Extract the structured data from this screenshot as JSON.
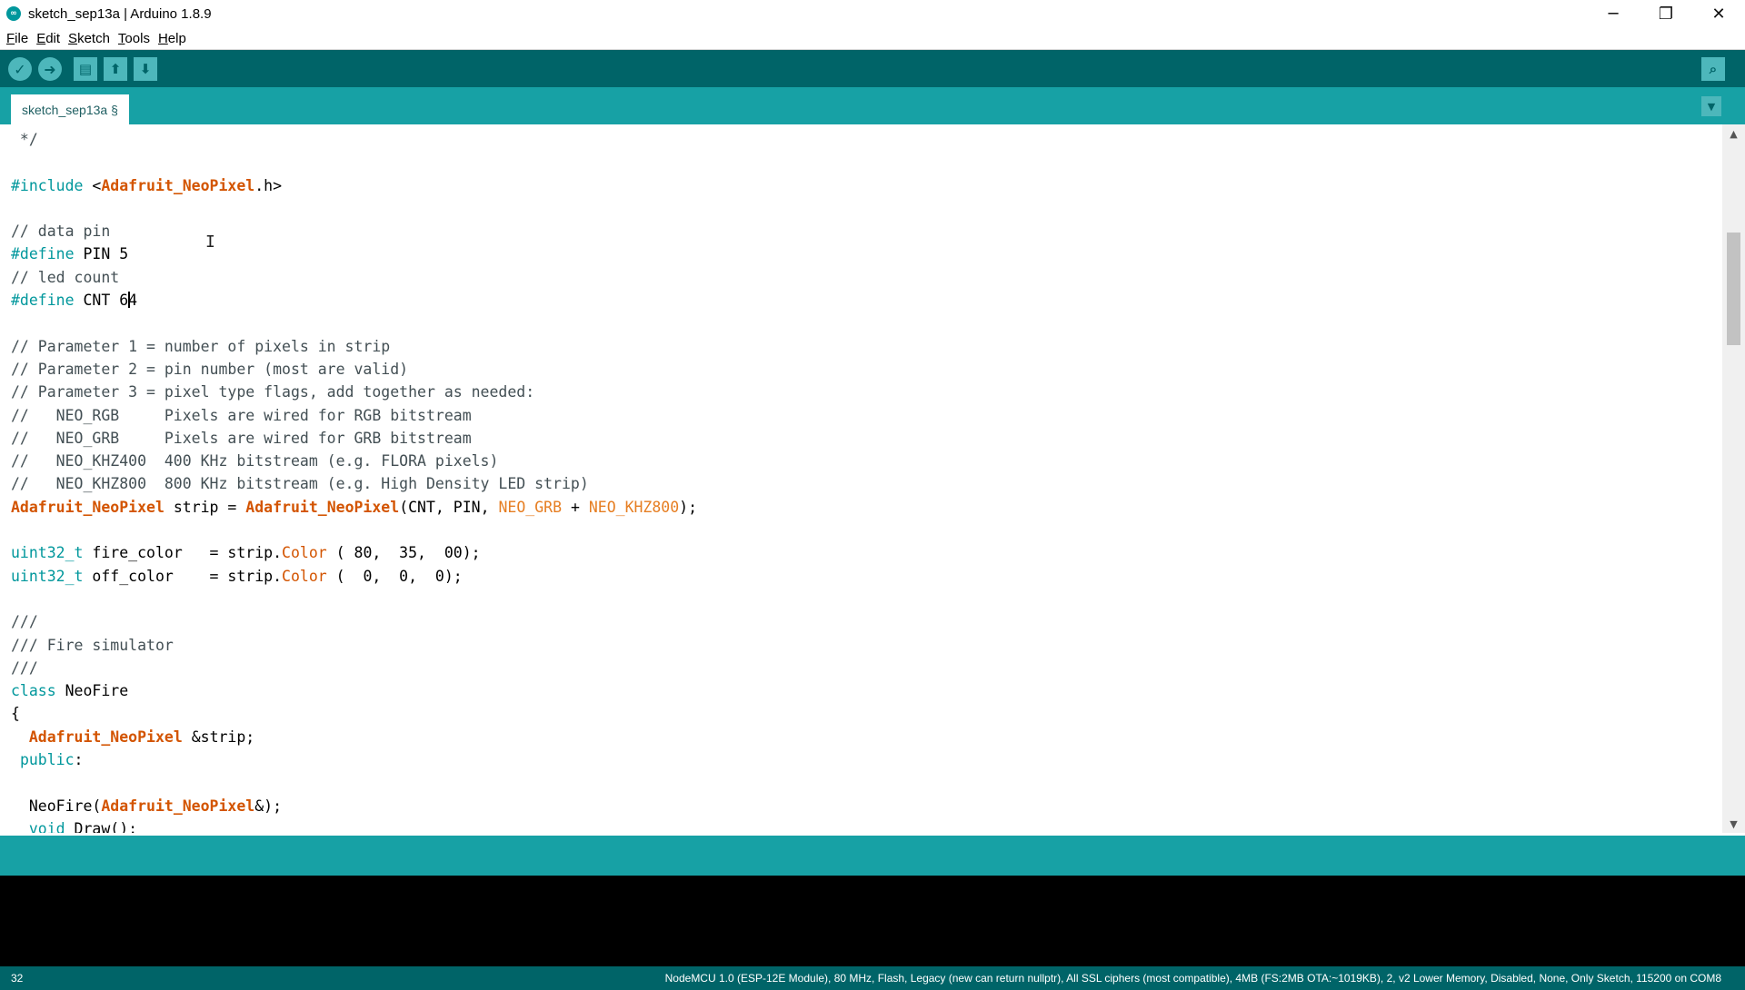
{
  "window": {
    "title": "sketch_sep13a | Arduino 1.8.9",
    "app_icon": "arduino-logo-icon",
    "controls": {
      "minimize": "─",
      "restore": "❐",
      "close": "✕"
    }
  },
  "menu": [
    "File",
    "Edit",
    "Sketch",
    "Tools",
    "Help"
  ],
  "toolbar": {
    "verify": "✓",
    "upload": "➜",
    "new": "▤",
    "open": "⬆",
    "save": "⬇",
    "serial_monitor": "⌕"
  },
  "tabs": {
    "active": "sketch_sep13a §",
    "menu": "▼"
  },
  "editor": {
    "lines": [
      [
        {
          "t": " */",
          "c": "cm"
        }
      ],
      [],
      [
        {
          "t": "#include ",
          "c": "kw"
        },
        {
          "t": "<",
          "c": ""
        },
        {
          "t": "Adafruit_NeoPixel",
          "c": "ty"
        },
        {
          "t": ".h>",
          "c": ""
        }
      ],
      [],
      [
        {
          "t": "// data pin",
          "c": "cm"
        }
      ],
      [
        {
          "t": "#define",
          "c": "kw"
        },
        {
          "t": " PIN 5",
          "c": ""
        }
      ],
      [
        {
          "t": "// led count",
          "c": "cm"
        }
      ],
      [
        {
          "t": "#define",
          "c": "kw"
        },
        {
          "t": " CNT 6",
          "c": ""
        },
        {
          "t": "|",
          "c": "caret"
        },
        {
          "t": "4",
          "c": ""
        }
      ],
      [],
      [
        {
          "t": "// Parameter 1 = number of pixels in strip",
          "c": "cm"
        }
      ],
      [
        {
          "t": "// Parameter 2 = pin number (most are valid)",
          "c": "cm"
        }
      ],
      [
        {
          "t": "// Parameter 3 = pixel type flags, add together as needed:",
          "c": "cm"
        }
      ],
      [
        {
          "t": "//   NEO_RGB     Pixels are wired for RGB bitstream",
          "c": "cm"
        }
      ],
      [
        {
          "t": "//   NEO_GRB     Pixels are wired for GRB bitstream",
          "c": "cm"
        }
      ],
      [
        {
          "t": "//   NEO_KHZ400  400 KHz bitstream (e.g. FLORA pixels)",
          "c": "cm"
        }
      ],
      [
        {
          "t": "//   NEO_KHZ800  800 KHz bitstream (e.g. High Density LED strip)",
          "c": "cm"
        }
      ],
      [
        {
          "t": "Adafruit_NeoPixel",
          "c": "ty"
        },
        {
          "t": " strip = ",
          "c": ""
        },
        {
          "t": "Adafruit_NeoPixel",
          "c": "ty"
        },
        {
          "t": "(CNT, PIN, ",
          "c": ""
        },
        {
          "t": "NEO_GRB",
          "c": "cs"
        },
        {
          "t": " + ",
          "c": ""
        },
        {
          "t": "NEO_KHZ800",
          "c": "cs"
        },
        {
          "t": ");",
          "c": ""
        }
      ],
      [],
      [
        {
          "t": "uint32_t",
          "c": "kw"
        },
        {
          "t": " fire_color   = strip.",
          "c": ""
        },
        {
          "t": "Color",
          "c": "fn"
        },
        {
          "t": " ( 80,  35,  00);",
          "c": ""
        }
      ],
      [
        {
          "t": "uint32_t",
          "c": "kw"
        },
        {
          "t": " off_color    = strip.",
          "c": ""
        },
        {
          "t": "Color",
          "c": "fn"
        },
        {
          "t": " (  0,  0,  0);",
          "c": ""
        }
      ],
      [],
      [
        {
          "t": "///",
          "c": "cm"
        }
      ],
      [
        {
          "t": "/// Fire simulator",
          "c": "cm"
        }
      ],
      [
        {
          "t": "///",
          "c": "cm"
        }
      ],
      [
        {
          "t": "class",
          "c": "kw"
        },
        {
          "t": " NeoFire",
          "c": ""
        }
      ],
      [
        {
          "t": "{",
          "c": ""
        }
      ],
      [
        {
          "t": "  ",
          "c": ""
        },
        {
          "t": "Adafruit_NeoPixel",
          "c": "ty"
        },
        {
          "t": " &strip;",
          "c": ""
        }
      ],
      [
        {
          "t": " ",
          "c": ""
        },
        {
          "t": "public",
          "c": "kw"
        },
        {
          "t": ":",
          "c": ""
        }
      ],
      [],
      [
        {
          "t": "  NeoFire(",
          "c": ""
        },
        {
          "t": "Adafruit_NeoPixel",
          "c": "ty"
        },
        {
          "t": "&);",
          "c": ""
        }
      ],
      [
        {
          "t": "  ",
          "c": ""
        },
        {
          "t": "void",
          "c": "kw"
        },
        {
          "t": " Draw();",
          "c": ""
        }
      ]
    ]
  },
  "scrollbar": {
    "up": "▲",
    "down": "▼"
  },
  "status": {
    "line": "32",
    "board": "NodeMCU 1.0 (ESP-12E Module), 80 MHz, Flash, Legacy (new can return nullptr), All SSL ciphers (most compatible), 4MB (FS:2MB OTA:~1019KB), 2, v2 Lower Memory, Disabled, None, Only Sketch, 115200 on COM8"
  }
}
